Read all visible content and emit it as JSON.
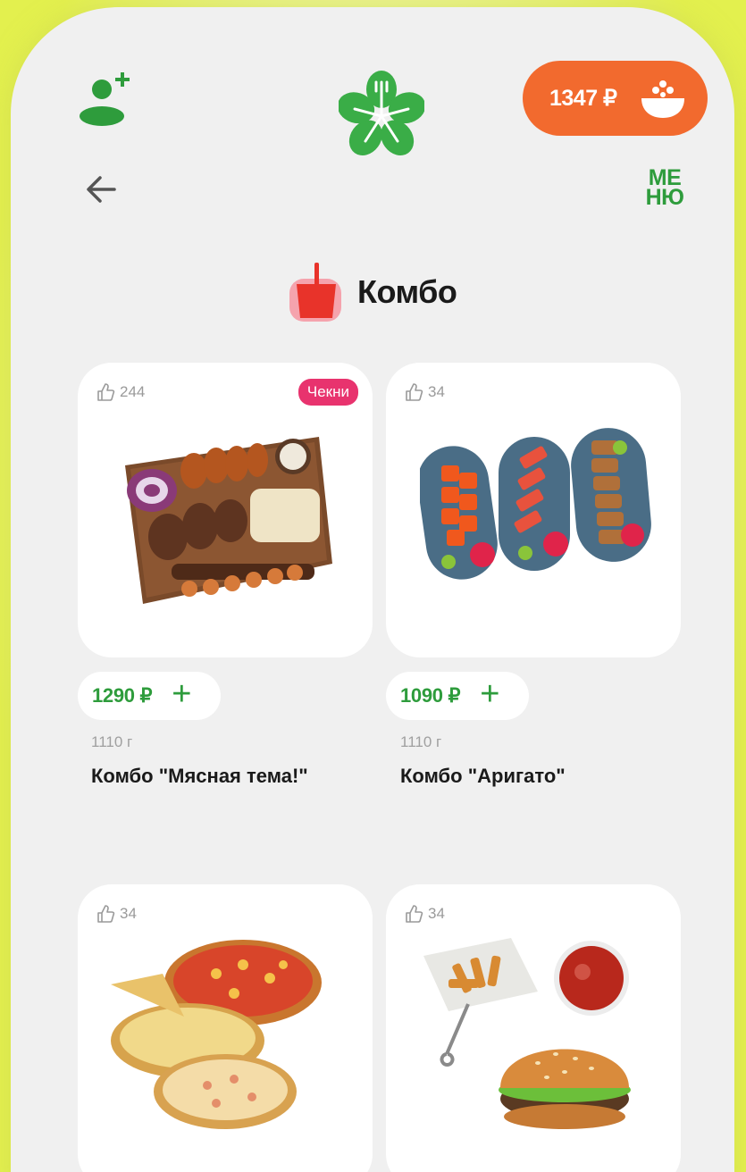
{
  "header": {
    "cart_total": "1347 ₽",
    "menu_line1": "МЕ",
    "menu_line2": "НЮ"
  },
  "section": {
    "title": "Комбо"
  },
  "products": [
    {
      "likes": "244",
      "badge": "Чекни",
      "price": "1290 ₽",
      "weight": "1110 г",
      "name": "Комбо \"Мясная тема!\""
    },
    {
      "likes": "34",
      "price": "1090 ₽",
      "weight": "1110 г",
      "name": "Комбо \"Аригато\""
    },
    {
      "likes": "34"
    },
    {
      "likes": "34"
    }
  ],
  "colors": {
    "accent_green": "#2e9c3c",
    "cart_orange": "#f26a2e",
    "badge_pink": "#e8336e",
    "background_lime": "#e6f25a"
  },
  "icons": [
    "add-user-icon",
    "logo-icon",
    "cart-bowl-icon",
    "arrow-left-icon",
    "cup-icon",
    "thumbs-up-icon",
    "plus-icon"
  ]
}
